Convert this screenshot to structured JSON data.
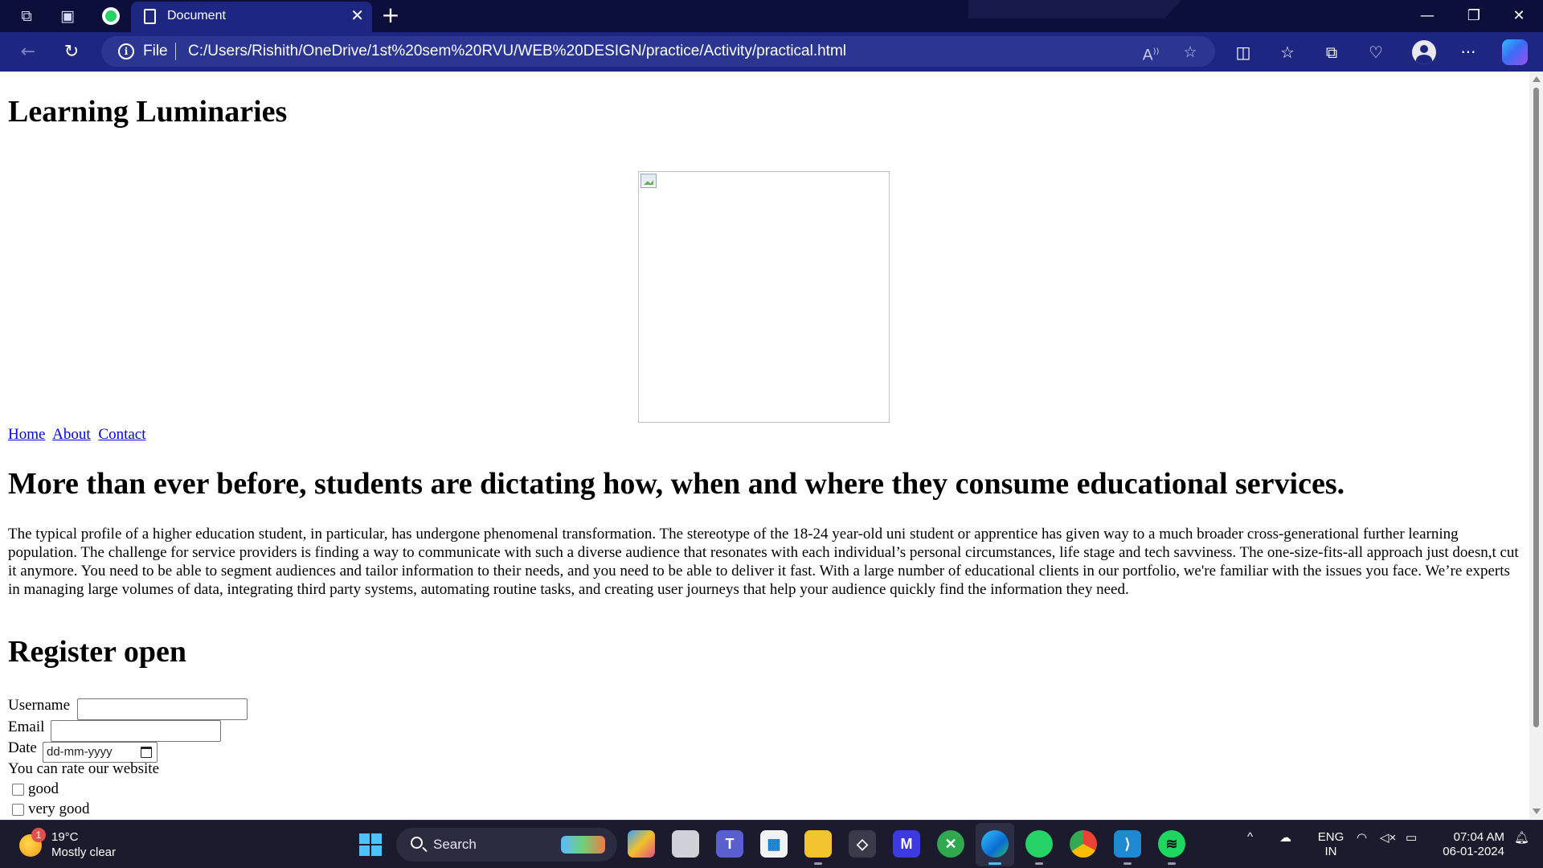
{
  "browser": {
    "tab_title": "Document",
    "new_tab": "+",
    "close_tab": "✕",
    "file_label": "File",
    "url": "C:/Users/Rishith/OneDrive/1st%20sem%20RVU/WEB%20DESIGN/practice/Activity/practical.html",
    "more": "···",
    "window_controls": {
      "minimize": "—",
      "restore": "❐",
      "close": "✕"
    }
  },
  "page": {
    "site_title": "Learning Luminaries",
    "nav_links": [
      "Home",
      "About",
      "Contact"
    ],
    "headline": "More than ever before, students are dictating how, when and where they consume educational services.",
    "paragraph": "The typical profile of a higher education student, in particular, has undergone phenomenal transformation. The stereotype of the 18-24 year-old uni student or apprentice has given way to a much broader cross-generational further learning population. The challenge for service providers is finding a way to communicate with such a diverse audience that resonates with each individual’s personal circumstances, life stage and tech savviness. The one-size-fits-all approach just doesn,t cut it anymore. You need to be able to segment audiences and tailor information to their needs, and you need to be able to deliver it fast. With a large number of educational clients in our portfolio, we're familiar with the issues you face. We’re experts in managing large volumes of data, integrating third party systems, automating routine tasks, and creating user journeys that help your audience quickly find the information they need.",
    "register_heading": "Register open",
    "form": {
      "username_label": "Username",
      "username_value": "",
      "email_label": "Email",
      "email_value": "",
      "date_label": "Date",
      "date_placeholder": "dd-mm-yyyy",
      "rating_prompt": "You can rate our website",
      "rating_options": [
        "good",
        "very good"
      ]
    }
  },
  "taskbar": {
    "weather_temp": "19°C",
    "weather_condition": "Mostly clear",
    "weather_badge": "1",
    "search_label": "Search",
    "language_top": "ENG",
    "language_bottom": "IN",
    "time": "07:04 AM",
    "date": "06-01-2024"
  },
  "colors": {
    "tabbar": "#0c0f3a",
    "toolbar": "#1d2782",
    "link": "#0000ee",
    "taskbar": "#1b1b2d"
  }
}
